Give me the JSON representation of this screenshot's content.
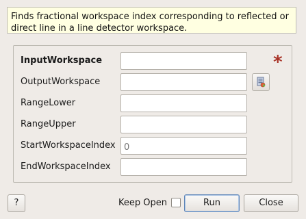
{
  "description": "Finds fractional workspace index corresponding to reflected or direct line in a line detector workspace.",
  "fields": [
    {
      "label": "InputWorkspace",
      "value": "",
      "placeholder": "",
      "required": true
    },
    {
      "label": "OutputWorkspace",
      "value": "",
      "placeholder": ""
    },
    {
      "label": "RangeLower",
      "value": "",
      "placeholder": ""
    },
    {
      "label": "RangeUpper",
      "value": "",
      "placeholder": ""
    },
    {
      "label": "StartWorkspaceIndex",
      "value": "",
      "placeholder": "0"
    },
    {
      "label": "EndWorkspaceIndex",
      "value": "",
      "placeholder": ""
    }
  ],
  "required_marker": "*",
  "footer": {
    "help_label": "?",
    "keep_open_label": "Keep Open",
    "keep_open_checked": false,
    "run_label": "Run",
    "close_label": "Close"
  },
  "colors": {
    "background": "#efebe7",
    "description_background": "#ffffe1",
    "required_marker": "#a83227"
  },
  "icons": {
    "browse": "workspace-browse-icon"
  }
}
